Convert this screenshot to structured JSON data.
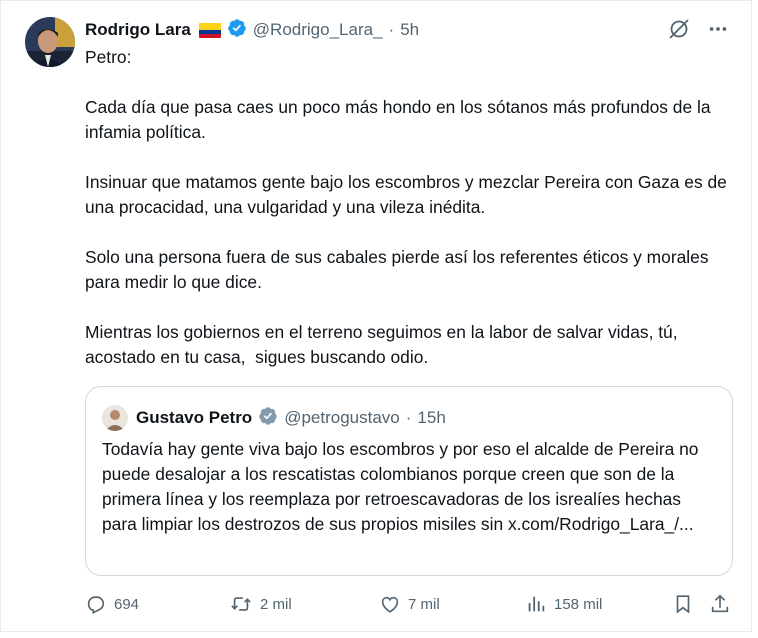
{
  "author": {
    "name": "Rodrigo Lara",
    "handle": "@Rodrigo_Lara_",
    "separator": "·",
    "time": "5h"
  },
  "tweet": {
    "text": "Petro:\n\nCada día que pasa caes un poco más hondo en los sótanos más profundos de la infamia política.\n\nInsinuar que matamos gente bajo los escombros y mezclar Pereira con Gaza es de una procacidad, una vulgaridad y una vileza inédita.\n\nSolo una persona fuera de sus cabales pierde así los referentes éticos y morales para medir lo que dice.\n\nMientras los gobiernos en el terreno seguimos en la labor de salvar vidas, tú, acostado en tu casa,  sigues buscando odio."
  },
  "quote": {
    "name": "Gustavo Petro",
    "handle": "@petrogustavo",
    "separator": "·",
    "time": "15h",
    "text": "Todavía hay gente viva bajo los escombros y por eso el alcalde de Pereira no puede desalojar a los rescatistas colombianos porque creen que son de la primera línea y los reemplaza por retroescavadoras de los isrealíes hechas para limpiar los destrozos de sus propios misiles sin x.com/Rodrigo_Lara_/..."
  },
  "actions": {
    "replies": "694",
    "reposts": "2 mil",
    "likes": "7 mil",
    "views": "158 mil"
  },
  "colors": {
    "verified": "#1d9bf0",
    "verified_gray": "#829aab",
    "muted": "#536471",
    "border": "#cfd9de",
    "flag_yellow": "#fcd116",
    "flag_blue": "#003893",
    "flag_red": "#ce1126"
  },
  "icons": [
    "grok-slash-icon",
    "more-icon",
    "reply-icon",
    "repost-icon",
    "like-icon",
    "views-icon",
    "bookmark-icon",
    "share-icon",
    "verified-badge-icon"
  ]
}
